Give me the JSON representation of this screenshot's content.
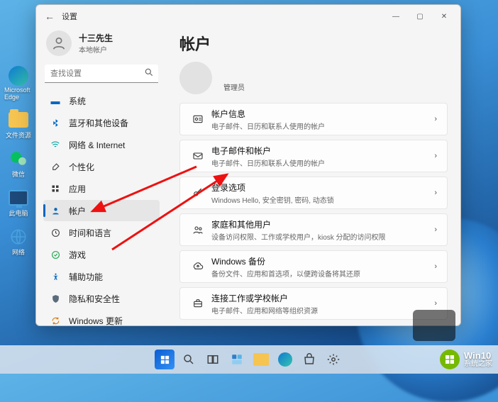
{
  "desktop": {
    "icons": [
      {
        "name": "microsoft-edge",
        "label": "Microsoft Edge"
      },
      {
        "name": "file-explorer",
        "label": "文件资源"
      },
      {
        "name": "wechat",
        "label": "微信"
      },
      {
        "name": "this-pc",
        "label": "此电脑"
      },
      {
        "name": "network",
        "label": "网络"
      }
    ]
  },
  "window": {
    "title": "设置",
    "profile": {
      "name": "十三先生",
      "sub": "本地帐户"
    },
    "search_placeholder": "查找设置",
    "nav": [
      {
        "icon": "system",
        "label": "系统",
        "color": "#0067c0"
      },
      {
        "icon": "bluetooth",
        "label": "蓝牙和其他设备",
        "color": "#0067c0"
      },
      {
        "icon": "network",
        "label": "网络 & Internet",
        "color": "#00a3a3"
      },
      {
        "icon": "personalize",
        "label": "个性化",
        "color": "#3b3b3b"
      },
      {
        "icon": "apps",
        "label": "应用",
        "color": "#3b3b3b"
      },
      {
        "icon": "accounts",
        "label": "帐户",
        "color": "#0067c0",
        "selected": true
      },
      {
        "icon": "time",
        "label": "时间和语言",
        "color": "#3b3b3b"
      },
      {
        "icon": "gaming",
        "label": "游戏",
        "color": "#16a34a"
      },
      {
        "icon": "accessibility",
        "label": "辅助功能",
        "color": "#0067c0"
      },
      {
        "icon": "privacy",
        "label": "隐私和安全性",
        "color": "#5a6b7a"
      },
      {
        "icon": "update",
        "label": "Windows 更新",
        "color": "#d97706"
      }
    ],
    "page": {
      "title": "帐户",
      "admin_label": "管理员",
      "cards": [
        {
          "icon": "card-info",
          "title": "帐户信息",
          "sub": "电子邮件、日历和联系人使用的帐户"
        },
        {
          "icon": "email",
          "title": "电子邮件和帐户",
          "sub": "电子邮件、日历和联系人使用的帐户"
        },
        {
          "icon": "key",
          "title": "登录选项",
          "sub": "Windows Hello, 安全密钥, 密码, 动态锁"
        },
        {
          "icon": "family",
          "title": "家庭和其他用户",
          "sub": "设备访问权限、工作或学校用户，kiosk 分配的访问权限"
        },
        {
          "icon": "backup",
          "title": "Windows 备份",
          "sub": "备份文件、应用和首选项，以便跨设备将其还原"
        },
        {
          "icon": "briefcase",
          "title": "连接工作或学校帐户",
          "sub": "电子邮件、应用和网络等组织资源"
        }
      ]
    }
  },
  "watermark": {
    "line1": "Win10",
    "line2": "系统之家"
  }
}
